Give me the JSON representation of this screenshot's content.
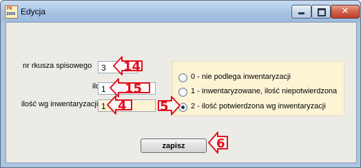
{
  "window": {
    "title": "Edycja",
    "icon_label_top": "FK",
    "icon_label_bottom": "2000"
  },
  "form": {
    "fields": [
      {
        "label": "nr rkusza spisowego",
        "value": "3"
      },
      {
        "label": "ilość",
        "value": "1"
      },
      {
        "label": "ilość wg inwentaryzacji",
        "value": "1"
      }
    ],
    "radio_options": [
      {
        "label": "0 - nie podlega inwentaryzacji",
        "selected": false
      },
      {
        "label": "1 - inwentaryzowane, ilość niepotwierdzona",
        "selected": false
      },
      {
        "label": "2 - ilość potwierdzona wg inwentaryzacji",
        "selected": true
      }
    ],
    "save_label": "zapisz"
  },
  "callouts": {
    "sheet_number": "14",
    "quantity": "15",
    "inventory_quantity": "4",
    "status_group": "5",
    "save_button": "6"
  },
  "colors": {
    "callout": "#e0101e",
    "readonly_background": "#fdf4d6"
  }
}
